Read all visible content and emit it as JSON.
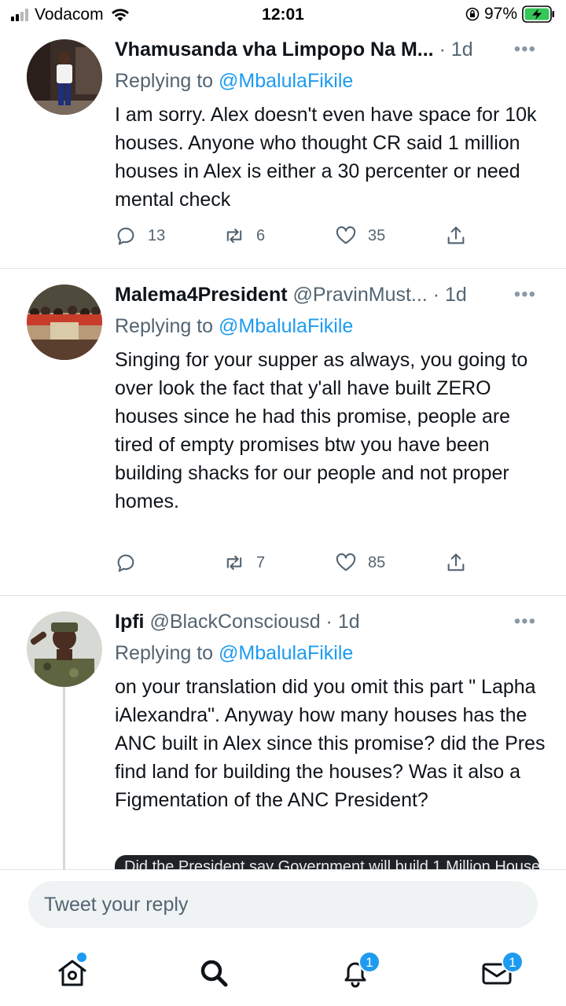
{
  "status_bar": {
    "carrier": "Vodacom",
    "time": "12:01",
    "battery_percent": "97%"
  },
  "tweets": [
    {
      "name": "Vhamusanda vha Limpopo Na M...",
      "handle": "",
      "time": "· 1d",
      "replying_prefix": "Replying to",
      "replying_to": "@MbalulaFikile",
      "text": "I am sorry. Alex doesn't even have space for 10k houses. Anyone who thought CR said 1 million houses in Alex is either a 30 percenter or need mental check",
      "replies": "13",
      "retweets": "6",
      "likes": "35"
    },
    {
      "name": "Malema4President",
      "handle": "@PravinMust...",
      "time": "· 1d",
      "replying_prefix": "Replying to",
      "replying_to": "@MbalulaFikile",
      "text": "Singing for your supper as always, you going to over look the fact that y'all have built ZERO houses since he had this promise, people are tired of empty promises btw you have been building shacks for our people and not proper homes.",
      "replies": "",
      "retweets": "7",
      "likes": "85"
    },
    {
      "name": "Ipfi",
      "handle": "@BlackConsciousd",
      "time": "· 1d",
      "replying_prefix": "Replying to",
      "replying_to": "@MbalulaFikile",
      "text": "on your translation did you omit this part \" Lapha iAlexandra\". Anyway how many houses has the ANC built in Alex since this promise? did the Pres find land for building the houses? Was it also a Figmentation of the ANC President?",
      "media_caption": "Did the President say Government will build 1 Million House"
    }
  ],
  "reply_bar": {
    "placeholder": "Tweet your reply"
  },
  "nav": {
    "notifications_count": "1",
    "messages_count": "1"
  },
  "colors": {
    "accent": "#1d9bf0",
    "secondary_text": "#536471",
    "divider": "#e1e6ea"
  }
}
